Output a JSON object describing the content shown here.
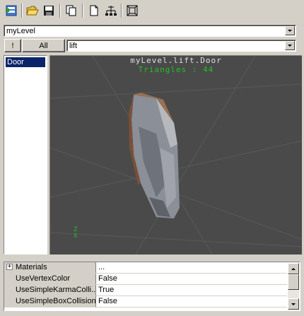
{
  "toolbar": {
    "buttons": [
      "level-manager-icon",
      "open-folder-icon",
      "save-icon",
      "copy-icon",
      "new-page-icon",
      "tree-icon",
      "frame-icon"
    ]
  },
  "level_select": {
    "value": "myLevel"
  },
  "filter": {
    "exclaim_label": "!",
    "all_label": "All",
    "value": "lift"
  },
  "object_list": {
    "items": [
      "Door"
    ]
  },
  "viewport": {
    "title": "myLevel.lift.Door",
    "triangles": "Triangles : 44",
    "axis_label": "Z\nX"
  },
  "properties": [
    {
      "name": "Materials",
      "value": "...",
      "expandable": true
    },
    {
      "name": "UseVertexColor",
      "value": "False",
      "expandable": false
    },
    {
      "name": "UseSimpleKarmaColli...",
      "value": "True",
      "expandable": false
    },
    {
      "name": "UseSimpleBoxCollision",
      "value": "False",
      "expandable": false
    }
  ]
}
